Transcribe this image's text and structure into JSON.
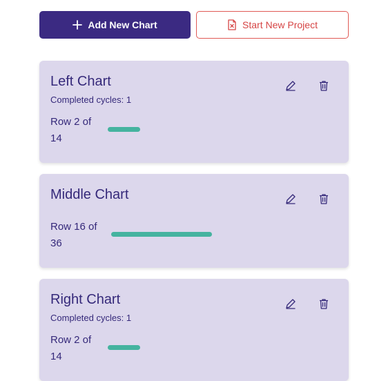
{
  "toolbar": {
    "add_label": "Add New Chart",
    "new_project_label": "Start New Project"
  },
  "charts": [
    {
      "title": "Left Chart",
      "completed": "Completed cycles: 1",
      "row_text": "Row 2 of 14",
      "progress": 0.143
    },
    {
      "title": "Middle Chart",
      "completed": "",
      "row_text": "Row 16 of 36",
      "progress": 0.444
    },
    {
      "title": "Right Chart",
      "completed": "Completed cycles: 1",
      "row_text": "Row 2 of 14",
      "progress": 0.143
    }
  ],
  "colors": {
    "primary": "#3b2a82",
    "danger": "#d64545",
    "card_bg": "#dcd7ec",
    "progress": "#45b39f",
    "text": "#35297a"
  },
  "icons": {
    "add": "plus-icon",
    "new_project": "file-x-icon",
    "edit": "pencil-icon",
    "delete": "trash-icon"
  }
}
